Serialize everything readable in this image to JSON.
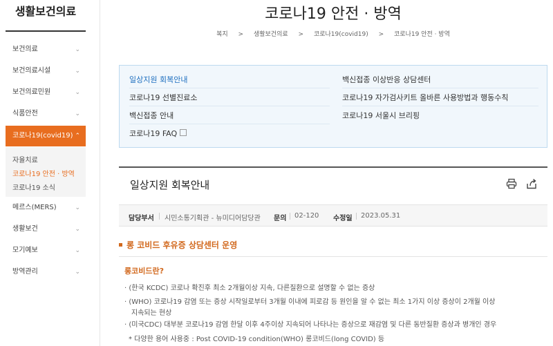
{
  "sidebar": {
    "title": "생활보건의료",
    "items": [
      {
        "label": "보건의료"
      },
      {
        "label": "보건의료시설"
      },
      {
        "label": "보건의료민원"
      },
      {
        "label": "식품안전"
      },
      {
        "label": "코로나19(covid19)"
      },
      {
        "label": "메르스(MERS)"
      },
      {
        "label": "생활보건"
      },
      {
        "label": "모기예보"
      },
      {
        "label": "방역관리"
      }
    ],
    "sub_items": [
      {
        "label": "자율치료"
      },
      {
        "label": "코로나19 안전 · 방역"
      },
      {
        "label": "코로나19 소식"
      }
    ],
    "chevron": "⌄",
    "chevron_up": "⌃"
  },
  "page": {
    "title": "코로나19 안전 · 방역",
    "breadcrumb": [
      "복지",
      "생활보건의료",
      "코로나19(covid19)",
      "코로나19 안전 · 방역"
    ],
    "breadcrumb_sep": ">"
  },
  "quick_links": [
    {
      "label": "일상지원 회복안내"
    },
    {
      "label": "백신접종 이상반응 상담센터"
    },
    {
      "label": "코로나19 선별진료소"
    },
    {
      "label": "코로나19 자가검사키트 올바른 사용방법과 행동수칙"
    },
    {
      "label": "백신접종 안내"
    },
    {
      "label": "코로나19 서울시 브리핑"
    },
    {
      "label": "코로나19 FAQ"
    }
  ],
  "article": {
    "title": "일상지원 회복안내",
    "meta": {
      "dept_label": "담당부서",
      "dept_value": "시민소통기획관 - 뉴미디어담당관",
      "contact_label": "문의",
      "contact_value": "02-120",
      "updated_label": "수정일",
      "updated_value": "2023.05.31"
    },
    "section_heading": "롱 코비드 후유증 상담센터 운영",
    "sub_heading": "롱코비드란?",
    "lines": [
      "· (한국 KCDC) 코로나 확진후 최소 2개월이상 지속, 다른질환으로 설명할 수 없는 증상",
      "· (WHO) 코로나19 감염 또는 증상 시작일로부터 3개월 이내에 피로감 등 원인을 알 수 없는 최소 1가지 이상 증상이 2개월 이상",
      "지속되는 현상",
      "· (미국CDC) 대부분 코로나19 감염 한달 이후 4주이상 지속되어 나타나는 증상으로 재감염 및 다른 동반질환 증상과 병개인 경우",
      "* 다양한 용어 사용중 : Post COVID-19 condition(WHO) 롱코비드(long COVID) 등"
    ]
  },
  "colors": {
    "accent": "#e86d1f",
    "link_blue": "#1e6fbf",
    "quick_bg": "#f1f7fc"
  }
}
